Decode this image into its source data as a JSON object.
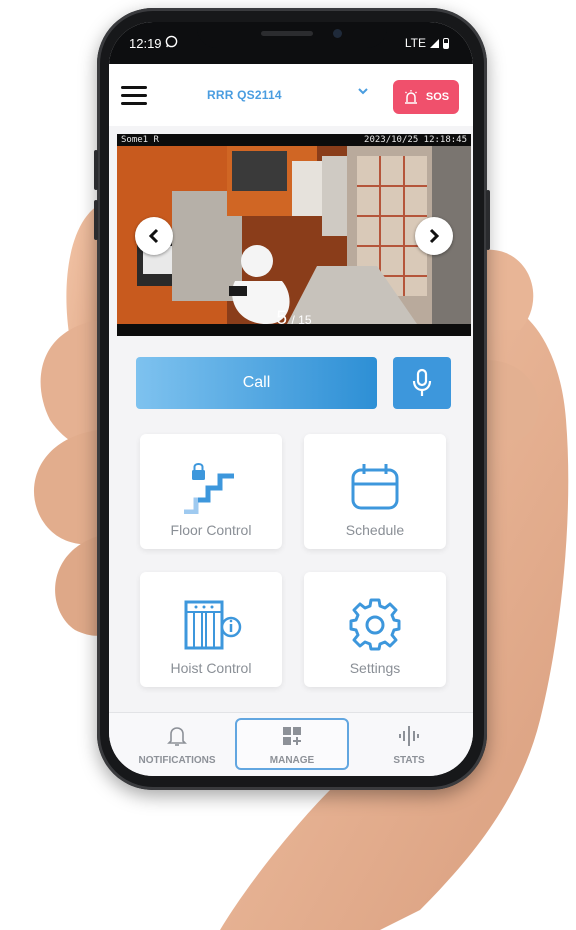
{
  "status_bar": {
    "time": "12:19",
    "network": "LTE"
  },
  "header": {
    "site": "RRR QS2114",
    "sos_label": "SOS"
  },
  "camera": {
    "osd_left": "Some1 R",
    "osd_right": "2023/10/25 12:18:45",
    "current": "5",
    "total": "/ 15"
  },
  "actions": {
    "call_label": "Call"
  },
  "tiles": [
    {
      "label": "Floor Control"
    },
    {
      "label": "Schedule"
    },
    {
      "label": "Hoist Control"
    },
    {
      "label": "Settings"
    }
  ],
  "tabs": [
    {
      "label": "NOTIFICATIONS"
    },
    {
      "label": "MANAGE",
      "active": true
    },
    {
      "label": "STATS"
    }
  ],
  "colors": {
    "accent": "#3d97dc",
    "sos": "#f0506c",
    "site_text": "#4a9de0"
  }
}
